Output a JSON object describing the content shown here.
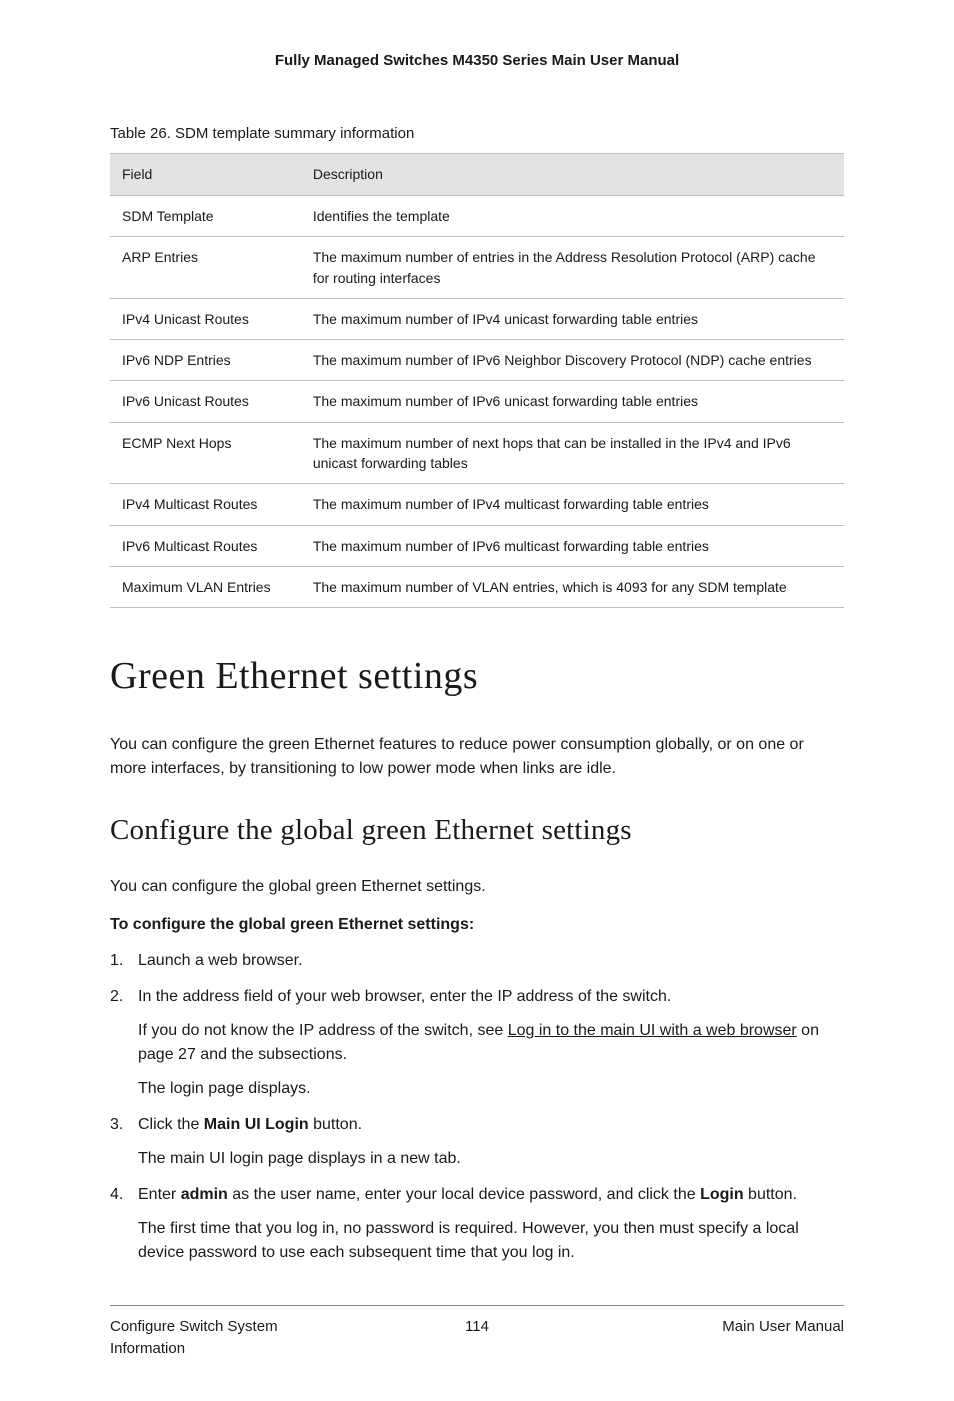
{
  "header": {
    "title": "Fully Managed Switches M4350 Series Main User Manual"
  },
  "table": {
    "caption": "Table 26. SDM template summary information",
    "col_field": "Field",
    "col_desc": "Description",
    "rows": [
      {
        "field": "SDM Template",
        "desc": "Identifies the template"
      },
      {
        "field": "ARP Entries",
        "desc": "The maximum number of entries in the Address Resolution Protocol (ARP) cache for routing interfaces"
      },
      {
        "field": "IPv4 Unicast Routes",
        "desc": "The maximum number of IPv4 unicast forwarding table entries"
      },
      {
        "field": "IPv6 NDP Entries",
        "desc": "The maximum number of IPv6 Neighbor Discovery Protocol (NDP) cache entries"
      },
      {
        "field": "IPv6 Unicast Routes",
        "desc": "The maximum number of IPv6 unicast forwarding table entries"
      },
      {
        "field": "ECMP Next Hops",
        "desc": "The maximum number of next hops that can be installed in the IPv4 and IPv6 unicast forwarding tables"
      },
      {
        "field": "IPv4 Multicast Routes",
        "desc": "The maximum number of IPv4 multicast forwarding table entries"
      },
      {
        "field": "IPv6 Multicast Routes",
        "desc": "The maximum number of IPv6 multicast forwarding table entries"
      },
      {
        "field": "Maximum VLAN Entries",
        "desc": "The maximum number of VLAN entries, which is 4093 for any SDM template"
      }
    ]
  },
  "section": {
    "h1": "Green Ethernet settings",
    "intro": "You can configure the green Ethernet features to reduce power consumption globally, or on one or more interfaces, by transitioning to low power mode when links are idle.",
    "h2": "Configure the global green Ethernet settings",
    "lead": "You can configure the global green Ethernet settings.",
    "procedure_title": "To configure the global green Ethernet settings:",
    "steps": {
      "s1": "Launch a web browser.",
      "s2": "In the address field of your web browser, enter the IP address of the switch.",
      "s2a_pre": "If you do not know the IP address of the switch, see ",
      "s2a_link": "Log in to the main UI with a web browser",
      "s2a_post": " on page 27 and the subsections.",
      "s2b": "The login page displays.",
      "s3_pre": "Click the ",
      "s3_bold": "Main UI Login",
      "s3_post": " button.",
      "s3a": "The main UI login page displays in a new tab.",
      "s4_pre": "Enter ",
      "s4_bold1": "admin",
      "s4_mid": " as the user name, enter your local device password, and click the ",
      "s4_bold2": "Login",
      "s4_post": " button.",
      "s4a": "The first time that you log in, no password is required. However, you then must specify a local device password to use each subsequent time that you log in."
    }
  },
  "footer": {
    "left": "Configure Switch System Information",
    "center": "114",
    "right": "Main User Manual"
  }
}
